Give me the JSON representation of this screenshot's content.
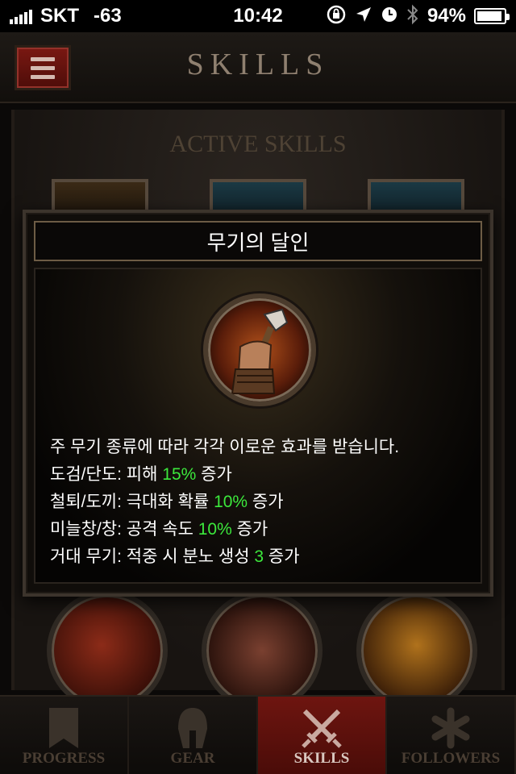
{
  "status_bar": {
    "carrier": "SKT",
    "signal_strength": "-63",
    "time": "10:42",
    "battery_percent": "94%",
    "icons": [
      "orientation-lock-icon",
      "location-arrow-icon",
      "alarm-clock-icon",
      "bluetooth-icon",
      "battery-icon"
    ],
    "battery_level": 0.94
  },
  "header": {
    "title": "SKILLS",
    "menu_icon": "hamburger-menu-icon"
  },
  "main": {
    "section_title": "ACTIVE SKILLS"
  },
  "tooltip": {
    "title": "무기의 달인",
    "icon": "weapon-master-skill-icon",
    "description": "주 무기 종류에 따라 각각 이로운 효과를 받습니다.",
    "lines": [
      {
        "prefix": "도검/단도: 피해 ",
        "value": "15%",
        "suffix": " 증가"
      },
      {
        "prefix": "철퇴/도끼: 극대화 확률 ",
        "value": "10%",
        "suffix": " 증가"
      },
      {
        "prefix": "미늘창/창: 공격 속도 ",
        "value": "10%",
        "suffix": " 증가"
      },
      {
        "prefix": "거대 무기: 적중 시 분노 생성 ",
        "value": "3",
        "suffix": " 증가"
      }
    ]
  },
  "tabs": [
    {
      "label": "PROGRESS",
      "icon": "bookmark-banner-icon",
      "active": false
    },
    {
      "label": "GEAR",
      "icon": "helmet-icon",
      "active": false
    },
    {
      "label": "SKILLS",
      "icon": "crossed-swords-icon",
      "active": true
    },
    {
      "label": "FOLLOWERS",
      "icon": "asterisk-icon",
      "active": false
    }
  ],
  "colors": {
    "accent_red": "#6e1510",
    "highlight_green": "#3ce83c",
    "title_gold": "#6d5c45"
  }
}
